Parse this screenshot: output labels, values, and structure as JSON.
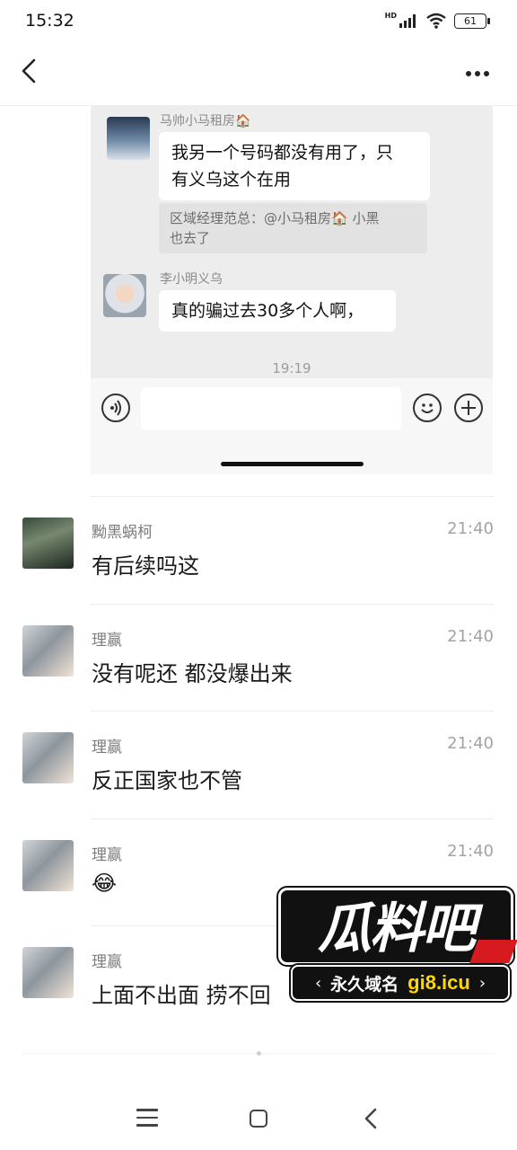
{
  "status_bar": {
    "time": "15:32",
    "network": "HD",
    "battery": "61"
  },
  "embedded_chat": {
    "messages": [
      {
        "sender": "马帅小马租房🏠",
        "text_line1": "我另一个号码都没有用了，只",
        "text_line2": "有义乌这个在用",
        "quote_line1": "区域经理范总：@小马租房🏠 小黑",
        "quote_line2": "也去了"
      },
      {
        "sender": "李小明义乌",
        "text": "真的骗过去30多个人啊，"
      }
    ],
    "time": "19:19"
  },
  "comments": [
    {
      "name": "黝黑蜗柯",
      "time": "21:40",
      "text": "有后续吗这"
    },
    {
      "name": "理赢",
      "time": "21:40",
      "text": "没有呢还 都没爆出来"
    },
    {
      "name": "理赢",
      "time": "21:40",
      "text": "反正国家也不管"
    },
    {
      "name": "理赢",
      "time": "21:40",
      "text": "😂"
    },
    {
      "name": "理赢",
      "time": "",
      "text": "上面不出面 捞不回"
    }
  ],
  "watermark": {
    "title": "瓜料吧",
    "left_text": "永久域名",
    "right_text": "gi8.icu"
  },
  "icons": [
    "back-icon",
    "more-icon",
    "voice-icon",
    "emoji-icon",
    "plus-icon",
    "menu-icon",
    "home-icon",
    "nav-back-icon"
  ],
  "colors": {
    "embed_bg": "#ededed",
    "bubble_bg": "#ffffff",
    "watermark_red": "#d71920",
    "watermark_yellow": "#ffd700"
  }
}
